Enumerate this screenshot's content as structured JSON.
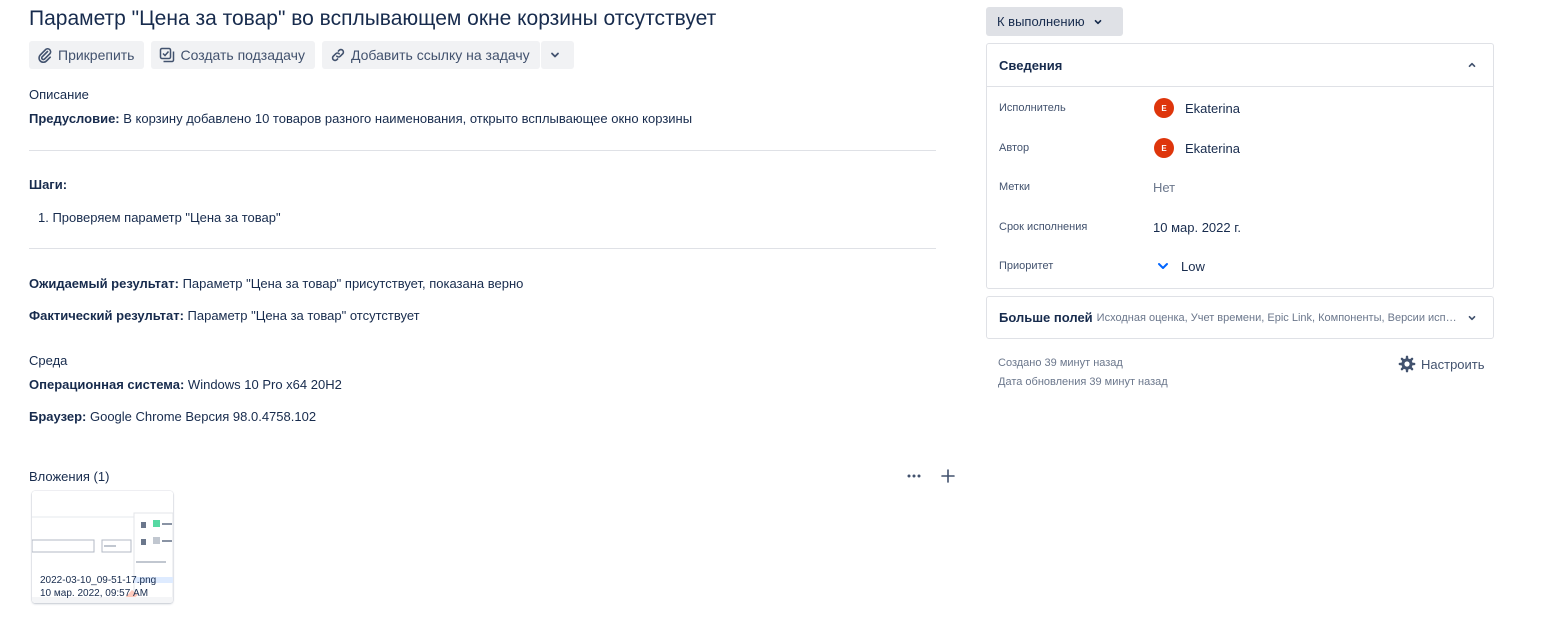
{
  "issue": {
    "title": "Параметр \"Цена за товар\" во всплывающем окне корзины отсутствует"
  },
  "toolbar": {
    "attach_label": "Прикрепить",
    "subtask_label": "Создать подзадачу",
    "link_label": "Добавить ссылку на задачу",
    "icons": [
      "paperclip-icon",
      "subtask-icon",
      "link-icon",
      "chevron-down-icon"
    ]
  },
  "description": {
    "heading": "Описание",
    "precondition_label": "Предусловие:",
    "precondition_text": " В корзину добавлено 10 товаров разного наименования, открыто всплывающее окно корзины",
    "steps_label": "Шаги:",
    "step_1": "1. Проверяем параметр \"Цена за товар\"",
    "expected_label": "Ожидаемый результат:",
    "expected_text": " Параметр \"Цена за товар\" присутствует, показана верно",
    "actual_label": "Фактический результат:",
    "actual_text": " Параметр \"Цена за товар\" отсутствует"
  },
  "environment": {
    "heading": "Среда",
    "os_label": "Операционная система:",
    "os_text": " Windows 10 Pro x64 20H2",
    "browser_label": "Браузер:",
    "browser_text": " Google Chrome Версия 98.0.4758.102"
  },
  "attachments": {
    "heading": "Вложения (1)",
    "files": [
      {
        "name": "2022-03-10_09-51-17.png",
        "date": "10 мар. 2022, 09:57 AM"
      }
    ]
  },
  "sidebar": {
    "status_label": "К выполнению",
    "details": {
      "heading": "Сведения",
      "assignee_label": "Исполнитель",
      "assignee_name": "Ekaterina",
      "assignee_initial": "E",
      "reporter_label": "Автор",
      "reporter_name": "Ekaterina",
      "reporter_initial": "E",
      "labels_label": "Метки",
      "labels_value": "Нет",
      "due_label": "Срок исполнения",
      "due_value": "10 мар. 2022 г.",
      "priority_label": "Приоритет",
      "priority_value": "Low"
    },
    "more_fields": {
      "title": "Больше полей",
      "summary": "Исходная оценка, Учет времени, Epic Link, Компоненты, Версии исправления"
    },
    "created": "Создано 39 минут назад",
    "updated": "Дата обновления 39 минут назад",
    "configure_label": "Настроить"
  },
  "colors": {
    "text": "#172b4d",
    "button_bg": "#f1f2f4",
    "status_bg": "#dfe1e6",
    "avatar": "#de350b",
    "priority_low": "#0065ff"
  }
}
